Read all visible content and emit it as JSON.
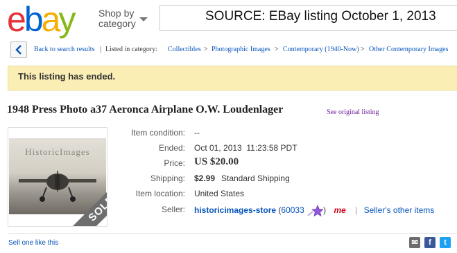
{
  "header": {
    "logo_letters": [
      {
        "char": "e",
        "color": "#e53238"
      },
      {
        "char": "b",
        "color": "#0064d2"
      },
      {
        "char": "a",
        "color": "#f5af02"
      },
      {
        "char": "y",
        "color": "#86b817"
      }
    ],
    "shop_by_line1": "Shop by",
    "shop_by_line2": "category",
    "search_overlay_text": "SOURCE: EBay listing October 1, 2013"
  },
  "breadcrumb": {
    "back_label": "Back to search results",
    "listed_in": "Listed in category:",
    "categories": [
      "Collectibles",
      "Photographic Images",
      "Contemporary (1940-Now)",
      "Other Contemporary Images"
    ]
  },
  "banner": {
    "message": "This listing has ended."
  },
  "item": {
    "title": "1948 Press Photo a37 Aeronca Airplane O.W. Loudenlager",
    "see_original": "See original listing",
    "image_brand": "HistoricImages",
    "sold_label": "SOLD"
  },
  "details": {
    "condition_label": "Item condition:",
    "condition_value": "--",
    "ended_label": "Ended:",
    "ended_value": "Oct 01, 2013  11:23:58 PDT",
    "price_label": "Price:",
    "price_value": "US $20.00",
    "shipping_label": "Shipping:",
    "shipping_cost": "$2.99",
    "shipping_method": "Standard Shipping",
    "location_label": "Item location:",
    "location_value": "United States",
    "seller_label": "Seller:",
    "seller_name": "historicimages-store",
    "seller_score": "60033",
    "me_badge": "me",
    "separator": "|",
    "other_items": "Seller's other items"
  },
  "footer": {
    "sell_one": "Sell one like this",
    "share_icons": [
      {
        "name": "email-share-icon",
        "glyph": "✉",
        "color": "#6d6d6d"
      },
      {
        "name": "facebook-share-icon",
        "glyph": "f",
        "color": "#3b5998"
      },
      {
        "name": "twitter-share-icon",
        "glyph": "t",
        "color": "#1da1f2"
      }
    ]
  }
}
